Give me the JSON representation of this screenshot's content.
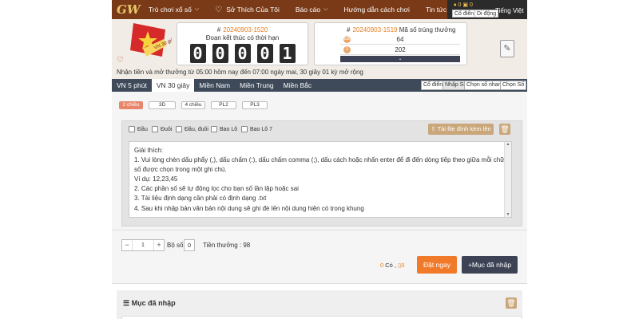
{
  "logo": "GW",
  "nav": {
    "items": [
      {
        "label": "Trò chơi xổ số",
        "caret": true
      },
      {
        "label": "Sở Thích Của Tôi",
        "heart": true
      },
      {
        "label": "Báo cáo",
        "caret": true
      },
      {
        "label": "Hướng dẫn cách chơi"
      },
      {
        "label": "Tin tức mới nhất"
      }
    ],
    "coins": "0",
    "coins2": "0",
    "mode_classic": "Cổ điển",
    "mode_mobile": "Di động",
    "language": "Tiếng Việt"
  },
  "flag_text": "VN 30 giây",
  "current_draw": {
    "id": "20240903-1520",
    "hash": "#",
    "label": "Đoạn kết thúc có thời hạn",
    "digits": [
      "0",
      "0",
      "0",
      "0",
      "1"
    ]
  },
  "prev_draw": {
    "id": "20240903-1519",
    "hash": "#",
    "label": "Mã số trúng thưởng",
    "rows": [
      {
        "ball": "ĐB",
        "value": "64"
      },
      {
        "ball": "1",
        "value": "202"
      }
    ]
  },
  "notice": "Nhận tiền và mở thưởng từ 05:00 hôm nay đến 07:00 ngày mai,    30 giây 01 kỳ mở rộng",
  "tabs": [
    "VN 5 phút",
    "VN 30 giây",
    "Miền Nam",
    "Miền Trung",
    "Miền Bắc"
  ],
  "subtabs": [
    "Cổ điển",
    "Nhập Số",
    "Chọn số nhanh",
    "Chọn Số"
  ],
  "game_types": [
    "2 chiều",
    "3D",
    "4 chiều",
    "PL2",
    "PL3"
  ],
  "options": [
    "Đầu",
    "Đuôi",
    "Đầu, đuôi",
    "Bao Lô",
    "Bao Lô 7"
  ],
  "upload_label": "Tải file đính kèm lên",
  "instructions": [
    "Giải thích:",
    "1. Vui lòng chèn dấu phẩy (,), dấu chấm (:), dấu chấm comma (;), dấu cách hoặc nhấn enter để đi đến dòng tiếp theo giữa mỗi chữ số được chọn trong một ghi chú.",
    "Ví dụ: 12,23,45",
    "2. Các phần số sẽ tự động lọc cho bạn số lần lặp hoặc sai",
    "3. Tài liệu định dạng cần phải có định dạng .txt",
    "4. Sau khi nhập bản văn bản nội dung sẽ ghi đè lên nội dung hiện có trong khung"
  ],
  "multiplier": "1",
  "bo_so_label": "Bộ số",
  "bo_so_value": "0",
  "prize_label": "Tiền thưởng :",
  "prize_value": "98",
  "count_zero": "0",
  "count_label": "Có ,",
  "count_value": "0",
  "submit_label": "Đặt ngay",
  "added_label": "Mục đã nhập",
  "footer_title": "Mục đã nhập"
}
